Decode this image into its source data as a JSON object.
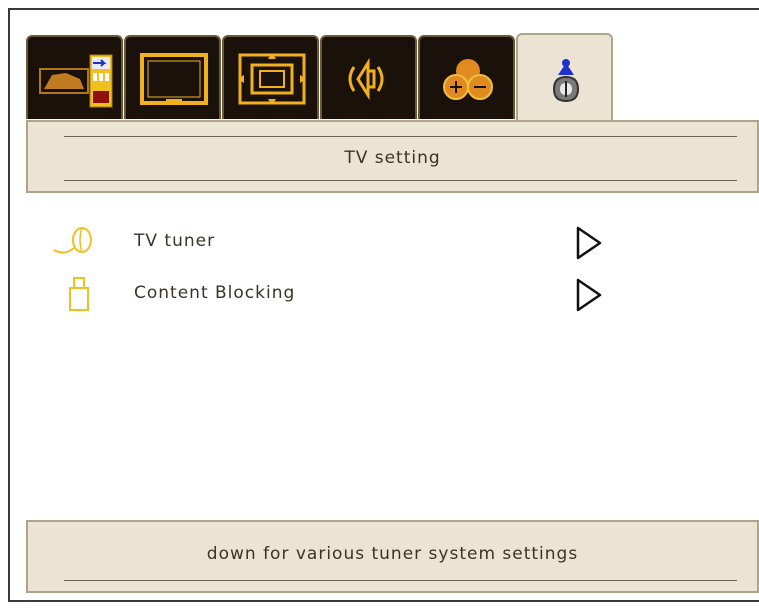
{
  "tabs": [
    {
      "icon": "picture-input-icon",
      "active": false
    },
    {
      "icon": "screen-icon",
      "active": false
    },
    {
      "icon": "picture-position-icon",
      "active": false
    },
    {
      "icon": "speaker-sound-icon",
      "active": false
    },
    {
      "icon": "feature-options-icon",
      "active": false
    },
    {
      "icon": "tv-setting-icon",
      "active": true
    }
  ],
  "header": {
    "title": "TV setting"
  },
  "menu": {
    "items": [
      {
        "label": "TV tuner",
        "icon": "tuner-icon",
        "arrow": "chevron-right-icon"
      },
      {
        "label": "Content Blocking",
        "icon": "lock-icon",
        "arrow": "chevron-right-icon"
      }
    ]
  },
  "footer": {
    "hint": "down for various tuner system settings"
  },
  "colors": {
    "panel_bg": "#ece4d2",
    "panel_border": "#b0a48a",
    "tab_dark": "#1a120a",
    "icon_gold": "#f0b020",
    "text": "#3a3326"
  }
}
